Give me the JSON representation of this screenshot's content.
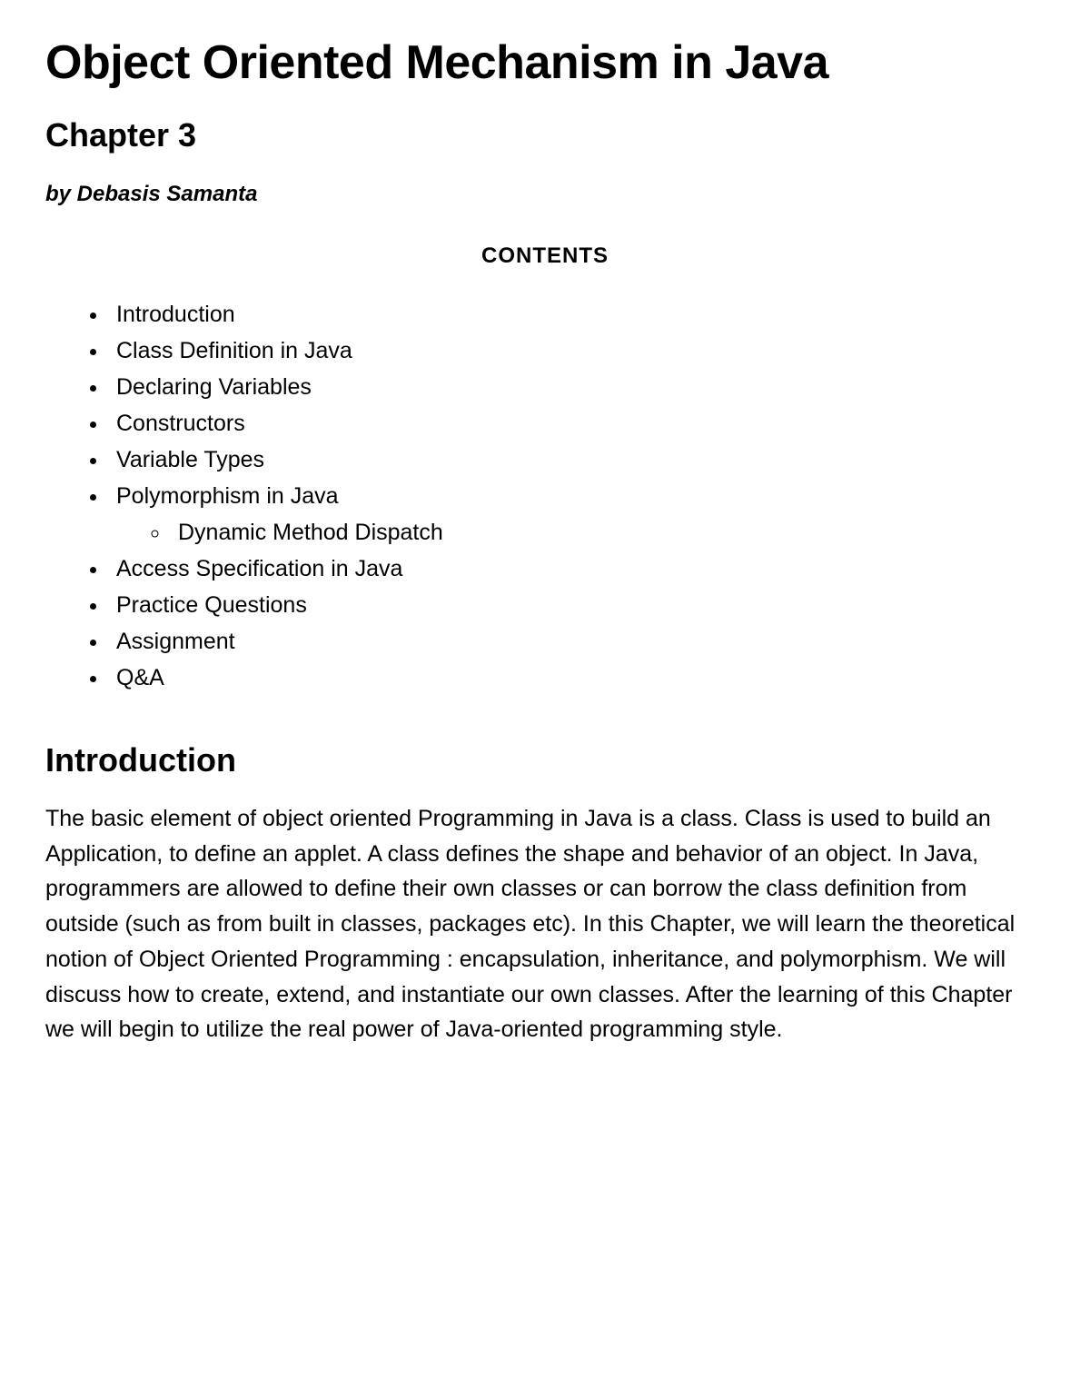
{
  "title": "Object Oriented Mechanism in Java",
  "chapter": "Chapter 3",
  "byline": "by Debasis Samanta",
  "contents_header": "CONTENTS",
  "toc": {
    "items": [
      "Introduction",
      "Class Definition in Java",
      "Declaring Variables",
      "Constructors",
      "Variable Types",
      "Polymorphism in Java",
      "Access Specification in Java",
      "Practice Questions",
      "Assignment",
      "Q&A"
    ],
    "polymorphism_sub": "Dynamic Method Dispatch"
  },
  "section": {
    "heading": "Introduction",
    "body": "The basic element of object oriented Programming in Java is a class. Class is used to build an Application, to define an applet. A class defines the shape and behavior of an object. In Java, programmers are allowed to define their own classes or can borrow the class definition from outside (such as from built in classes, packages etc). In this Chapter, we will learn the theoretical notion of Object Oriented Programming : encapsulation, inheritance, and polymorphism. We will discuss how to create, extend, and instantiate our own classes. After the learning of this Chapter we will begin to utilize the real power of Java-oriented programming style."
  }
}
